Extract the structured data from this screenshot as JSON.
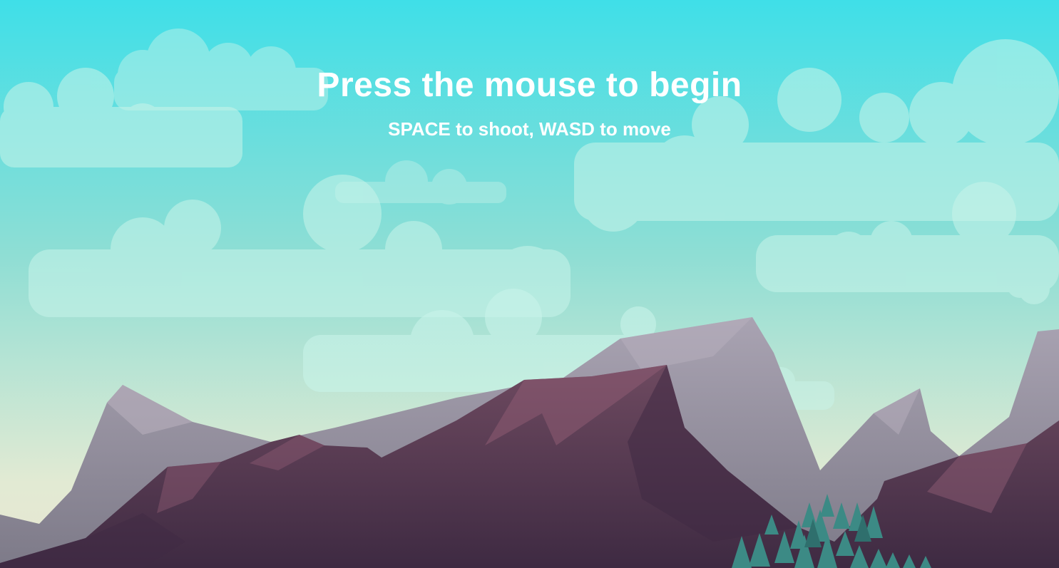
{
  "screen": "start",
  "prompt": {
    "title": "Press the mouse to begin",
    "subtitle": "SPACE to shoot, WASD to move"
  },
  "palette": {
    "sky_top": "#3fdfe8",
    "sky_mid": "#8fded4",
    "sky_bottom": "#e2ead3",
    "cloud": "#c9f4ea",
    "mountain_far": "#9c97a6",
    "mountain_near": "#5a3d55",
    "mountain_dark": "#3f2a44",
    "mountain_highlight": "#8e5b73",
    "tree": "#3c8a85",
    "text": "#ffffff"
  }
}
